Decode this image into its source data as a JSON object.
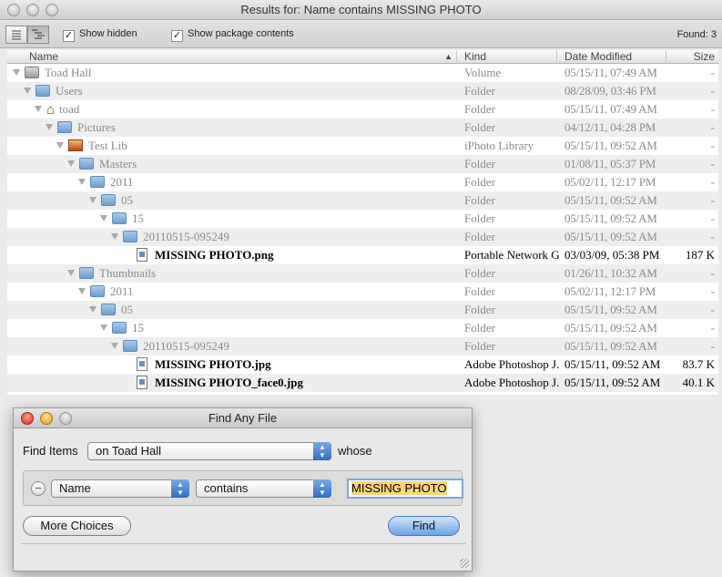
{
  "window": {
    "title": "Results for: Name contains MISSING PHOTO"
  },
  "toolbar": {
    "show_hidden_label": "Show hidden",
    "show_hidden_checked": true,
    "show_package_label": "Show package contents",
    "show_package_checked": true,
    "found_text": "Found: 3"
  },
  "columns": {
    "name": "Name",
    "kind": "Kind",
    "date": "Date Modified",
    "size": "Size"
  },
  "rows": [
    {
      "name": "Toad Hall",
      "kind": "Volume",
      "date": "05/15/11, 07:49 AM",
      "size": "-",
      "icon": "volume-icon"
    },
    {
      "name": "Users",
      "kind": "Folder",
      "date": "08/28/09, 03:46 PM",
      "size": "-",
      "icon": "users-folder-icon"
    },
    {
      "name": "toad",
      "kind": "Folder",
      "date": "05/15/11, 07:49 AM",
      "size": "-",
      "icon": "home-icon"
    },
    {
      "name": "Pictures",
      "kind": "Folder",
      "date": "04/12/11, 04:28 PM",
      "size": "-",
      "icon": "pictures-folder-icon"
    },
    {
      "name": "Test Lib",
      "kind": "iPhoto Library",
      "date": "05/15/11, 09:52 AM",
      "size": "-",
      "icon": "iphoto-library-icon"
    },
    {
      "name": "Masters",
      "kind": "Folder",
      "date": "01/08/11, 05:37 PM",
      "size": "-",
      "icon": "folder-icon"
    },
    {
      "name": "2011",
      "kind": "Folder",
      "date": "05/02/11, 12:17 PM",
      "size": "-",
      "icon": "folder-icon"
    },
    {
      "name": "05",
      "kind": "Folder",
      "date": "05/15/11, 09:52 AM",
      "size": "-",
      "icon": "folder-icon"
    },
    {
      "name": "15",
      "kind": "Folder",
      "date": "05/15/11, 09:52 AM",
      "size": "-",
      "icon": "folder-icon"
    },
    {
      "name": "20110515-095249",
      "kind": "Folder",
      "date": "05/15/11, 09:52 AM",
      "size": "-",
      "icon": "folder-icon"
    },
    {
      "name": "MISSING PHOTO.png",
      "kind": "Portable Network G...",
      "date": "03/03/09, 05:38 PM",
      "size": "187 K",
      "icon": "png-file-icon"
    },
    {
      "name": "Thumbnails",
      "kind": "Folder",
      "date": "01/26/11, 10:32 AM",
      "size": "-",
      "icon": "folder-icon"
    },
    {
      "name": "2011",
      "kind": "Folder",
      "date": "05/02/11, 12:17 PM",
      "size": "-",
      "icon": "folder-icon"
    },
    {
      "name": "05",
      "kind": "Folder",
      "date": "05/15/11, 09:52 AM",
      "size": "-",
      "icon": "folder-icon"
    },
    {
      "name": "15",
      "kind": "Folder",
      "date": "05/15/11, 09:52 AM",
      "size": "-",
      "icon": "folder-icon"
    },
    {
      "name": "20110515-095249",
      "kind": "Folder",
      "date": "05/15/11, 09:52 AM",
      "size": "-",
      "icon": "folder-icon"
    },
    {
      "name": "MISSING PHOTO.jpg",
      "kind": "Adobe Photoshop J...",
      "date": "05/15/11, 09:52 AM",
      "size": "83.7 K",
      "icon": "jpg-file-icon"
    },
    {
      "name": "MISSING PHOTO_face0.jpg",
      "kind": "Adobe Photoshop J...",
      "date": "05/15/11, 09:52 AM",
      "size": "40.1 K",
      "icon": "jpg-file-icon"
    }
  ],
  "dialog": {
    "title": "Find Any File",
    "find_items_label": "Find Items",
    "location_value": "on Toad Hall",
    "whose_label": "whose",
    "attribute_value": "Name",
    "operator_value": "contains",
    "search_value": "MISSING PHOTO",
    "more_choices_label": "More Choices",
    "find_label": "Find"
  }
}
